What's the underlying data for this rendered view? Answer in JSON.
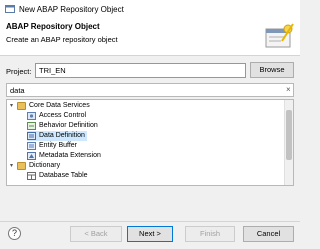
{
  "window": {
    "title": "New ABAP Repository Object"
  },
  "header": {
    "title": "ABAP Repository Object",
    "subtitle": "Create an ABAP repository object"
  },
  "project": {
    "label": "Project:",
    "value": "TRI_EN",
    "browse_label": "Browse"
  },
  "filter": {
    "value": "data",
    "clear_icon": "×"
  },
  "tree": {
    "items": [
      {
        "label": "Core Data Services",
        "icon": "folder-icon",
        "expanded": true
      },
      {
        "label": "Access Control",
        "icon": "access-control-icon"
      },
      {
        "label": "Behavior Definition",
        "icon": "behavior-definition-icon"
      },
      {
        "label": "Data Definition",
        "icon": "data-definition-icon",
        "selected": true
      },
      {
        "label": "Entity Buffer",
        "icon": "entity-buffer-icon"
      },
      {
        "label": "Metadata Extension",
        "icon": "metadata-extension-icon"
      },
      {
        "label": "Dictionary",
        "icon": "folder-icon",
        "expanded": true
      },
      {
        "label": "Database Table",
        "icon": "database-table-icon"
      }
    ]
  },
  "footer": {
    "help_label": "?",
    "back_label": "< Back",
    "next_label": "Next >",
    "finish_label": "Finish",
    "cancel_label": "Cancel"
  },
  "colors": {
    "selection": "#cde8ff",
    "accent": "#0078d7"
  }
}
